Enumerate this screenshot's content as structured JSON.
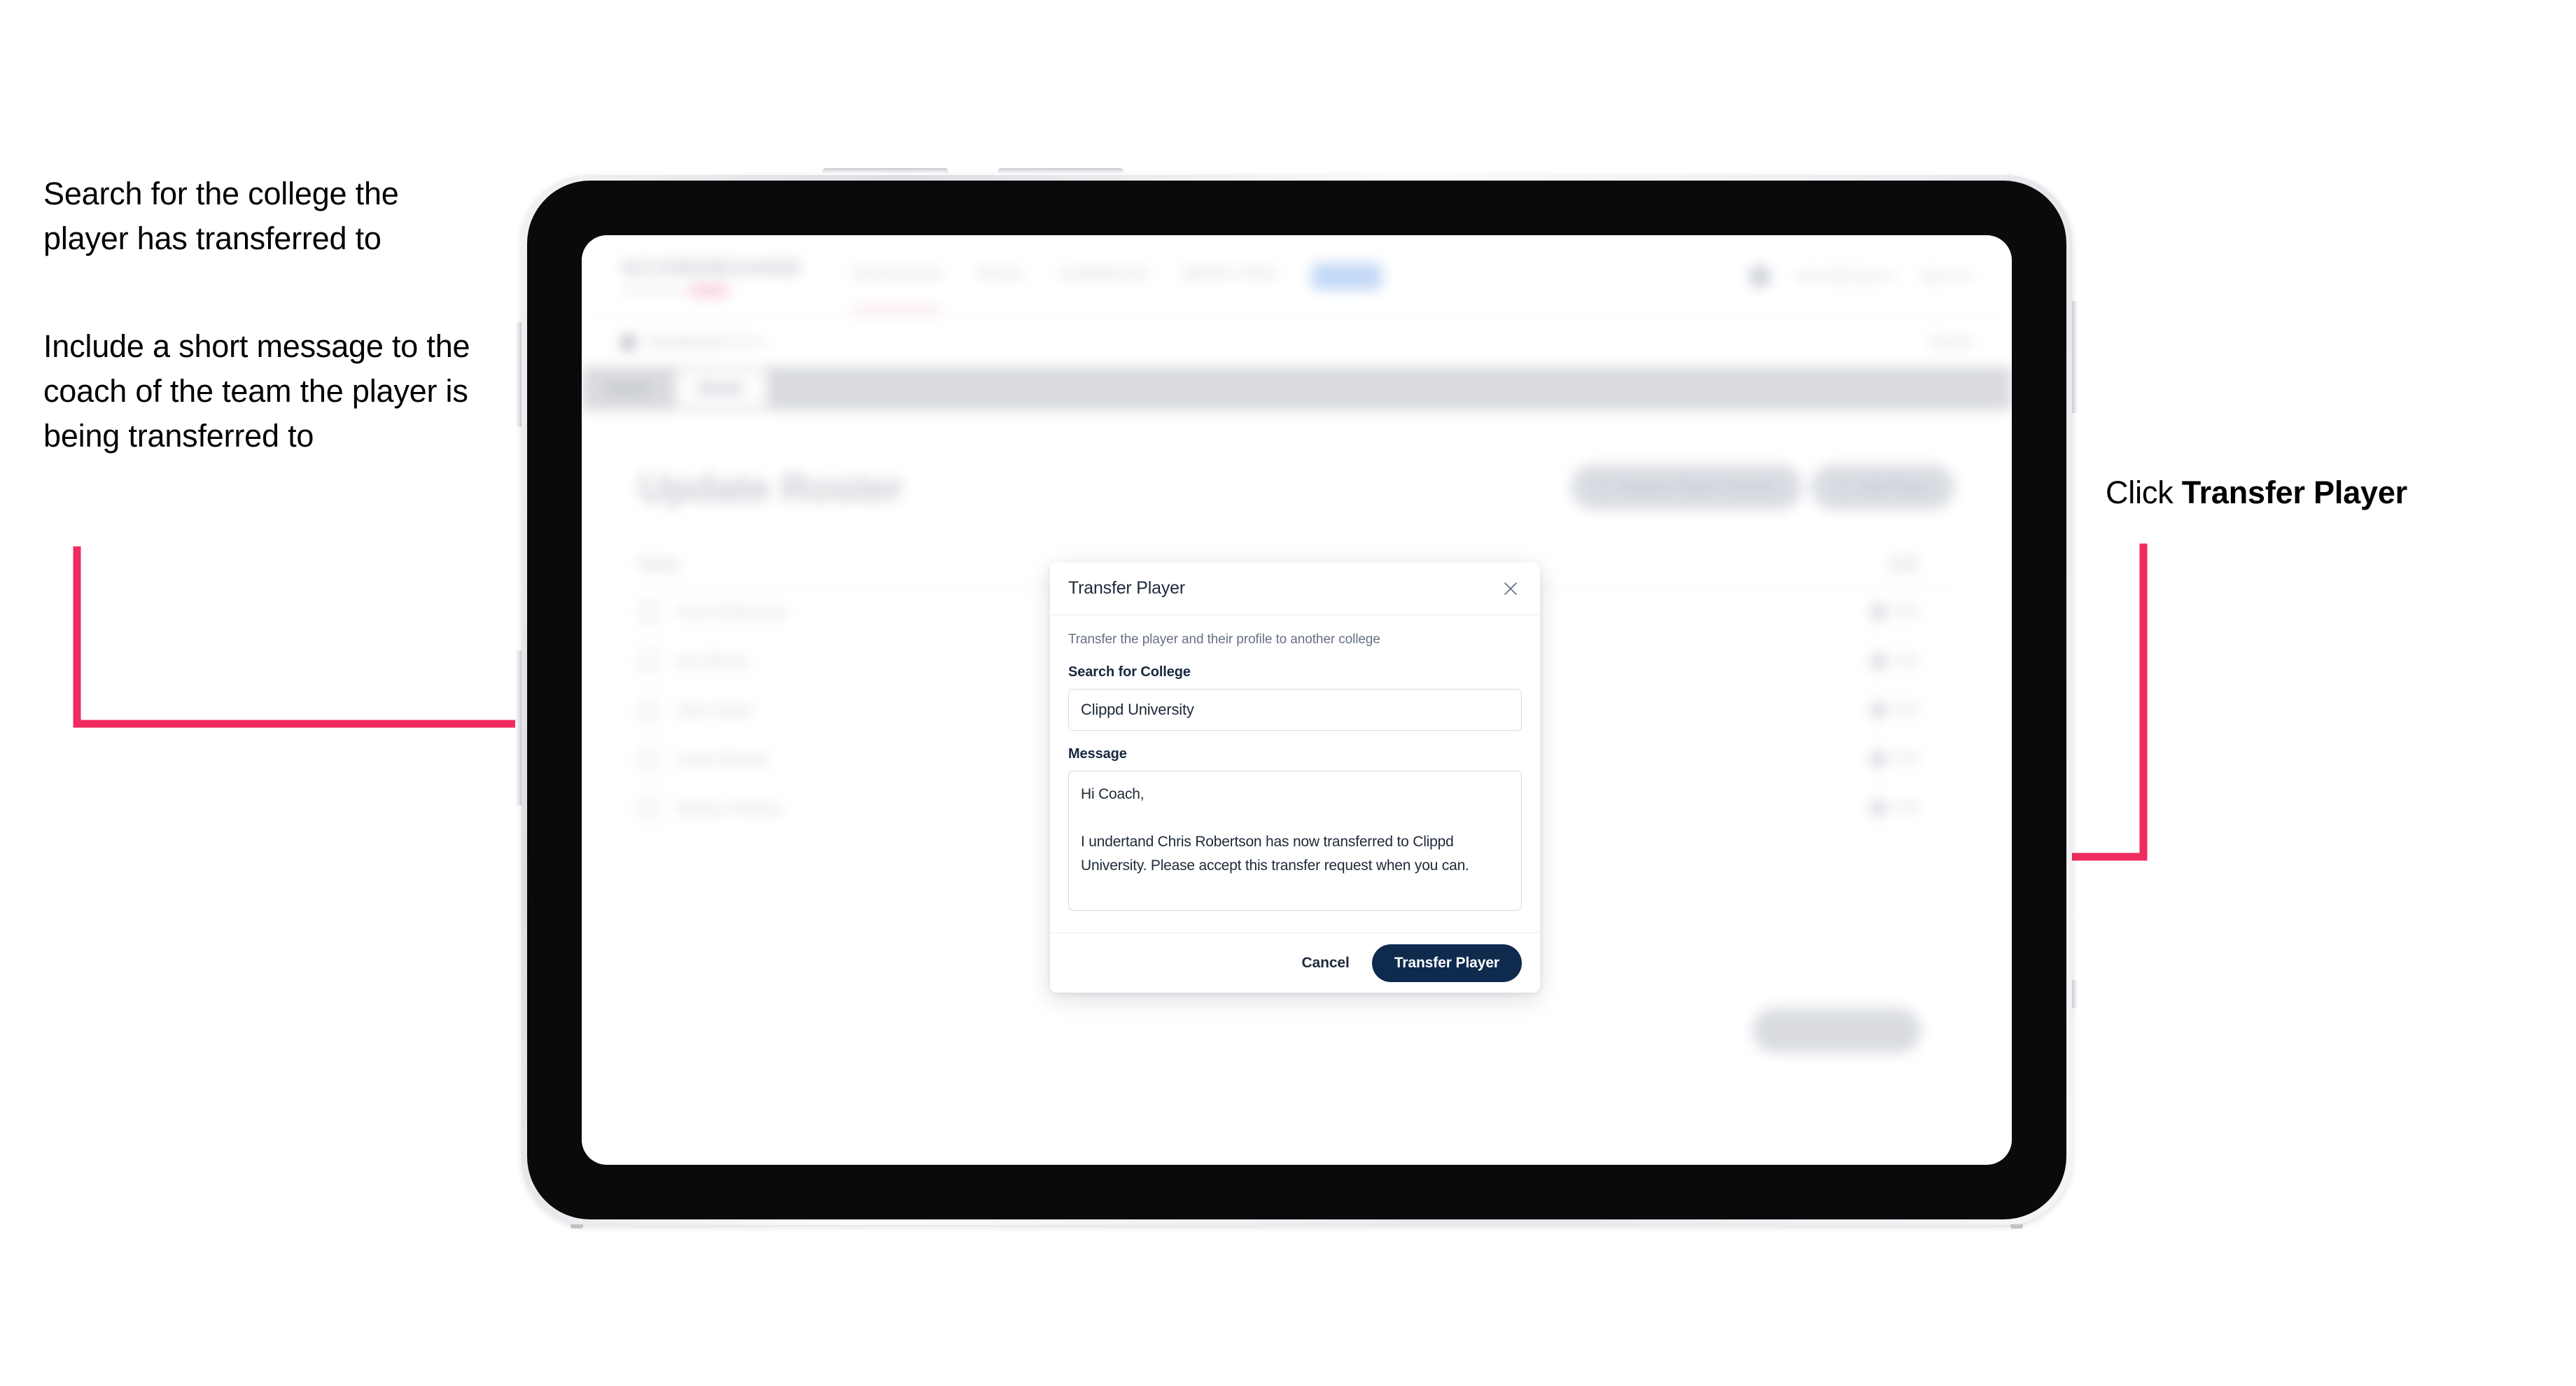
{
  "annotations": {
    "left_1": "Search for the college the player has transferred to",
    "left_2": "Include a short message to the coach of the team the player is being transferred to",
    "right_prefix": "Click ",
    "right_bold": "Transfer Player"
  },
  "colors": {
    "arrow": "#F02B5F",
    "primary_button": "#0E2A4D",
    "brand_accent": "#F7305F",
    "text_dark": "#1D2939",
    "text_muted": "#667085"
  },
  "app": {
    "brand": {
      "name": "SCOREBOARD",
      "subtitle": "Powered by",
      "chip": "clippd"
    },
    "nav": [
      {
        "label": "Tournaments"
      },
      {
        "label": "Teams"
      },
      {
        "label": "Leaderboard"
      },
      {
        "label": "WAGR / PGS"
      },
      {
        "label": "Admin"
      }
    ],
    "user": {
      "email": "admin@clippd.io",
      "sign_out": "Sign Out"
    },
    "breadcrumb": {
      "icon": "document-icon",
      "title": "Scoreboard",
      "subtitle": "Admin",
      "action": "Cancel"
    },
    "tabs": [
      {
        "label": "Details",
        "active": false
      },
      {
        "label": "Roster",
        "active": true
      }
    ],
    "page_title": "Update Roster",
    "header_buttons": [
      {
        "label": "Request Player Transfer",
        "icon": "transfer-icon"
      },
      {
        "label": "Add Player",
        "icon": "plus-icon"
      }
    ],
    "table": {
      "columns": [
        "Name",
        "Edit"
      ],
      "rows": [
        {
          "name": "Chris Robertson",
          "action": "Edit"
        },
        {
          "name": "Ian Wilson",
          "action": "Edit"
        },
        {
          "name": "Jake Taylor",
          "action": "Edit"
        },
        {
          "name": "Lewis Barnes",
          "action": "Edit"
        },
        {
          "name": "Nathan Holmes",
          "action": "Edit"
        }
      ]
    },
    "footer_button": "Save Roster Changes"
  },
  "modal": {
    "title": "Transfer Player",
    "close_icon": "close-icon",
    "subtitle": "Transfer the player and their profile to another college",
    "college_field": {
      "label": "Search for College",
      "value": "Clippd University",
      "placeholder": "Search for College"
    },
    "message_field": {
      "label": "Message",
      "value": "Hi Coach,\n\nI undertand Chris Robertson has now transferred to Clippd University. Please accept this transfer request when you can.",
      "placeholder": "Message"
    },
    "cancel_label": "Cancel",
    "submit_label": "Transfer Player"
  }
}
